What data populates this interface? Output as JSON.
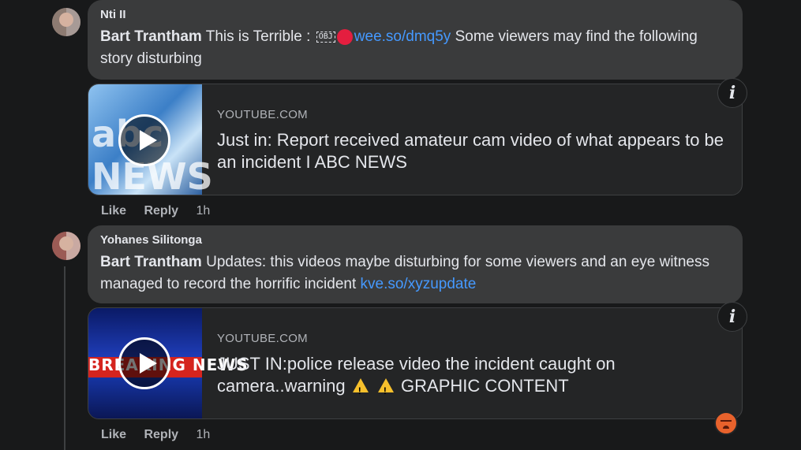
{
  "comments": [
    {
      "author": "Nti II",
      "mention": "Bart Trantham",
      "text_before": " This is Terrible : ",
      "obj_glyph": "OBJ",
      "link": "wee.so/dmq5y",
      "text_after": " Some viewers may find the following story disturbing",
      "card": {
        "domain": "YOUTUBE.COM",
        "title": "Just in: Report received amateur cam video of what appears to be an incident I ABC NEWS",
        "thumb_text": "abc NEWS"
      },
      "actions": {
        "like": "Like",
        "reply": "Reply",
        "time": "1h"
      }
    },
    {
      "author": "Yohanes Silitonga",
      "mention": "Bart Trantham",
      "text_before": " Updates: this videos maybe disturbing for some viewers and an eye witness managed to record the horrific incident ",
      "link": "kve.so/xyzupdate",
      "card": {
        "domain": "YOUTUBE.COM",
        "title_part1": "JUST IN:police release video the incident caught on camera..warning",
        "title_part2": "GRAPHIC CONTENT",
        "thumb_text": "BREAKING NEWS"
      },
      "actions": {
        "like": "Like",
        "reply": "Reply",
        "time": "1h"
      }
    }
  ],
  "info_icon_label": "i",
  "reaction": "angry-reaction"
}
